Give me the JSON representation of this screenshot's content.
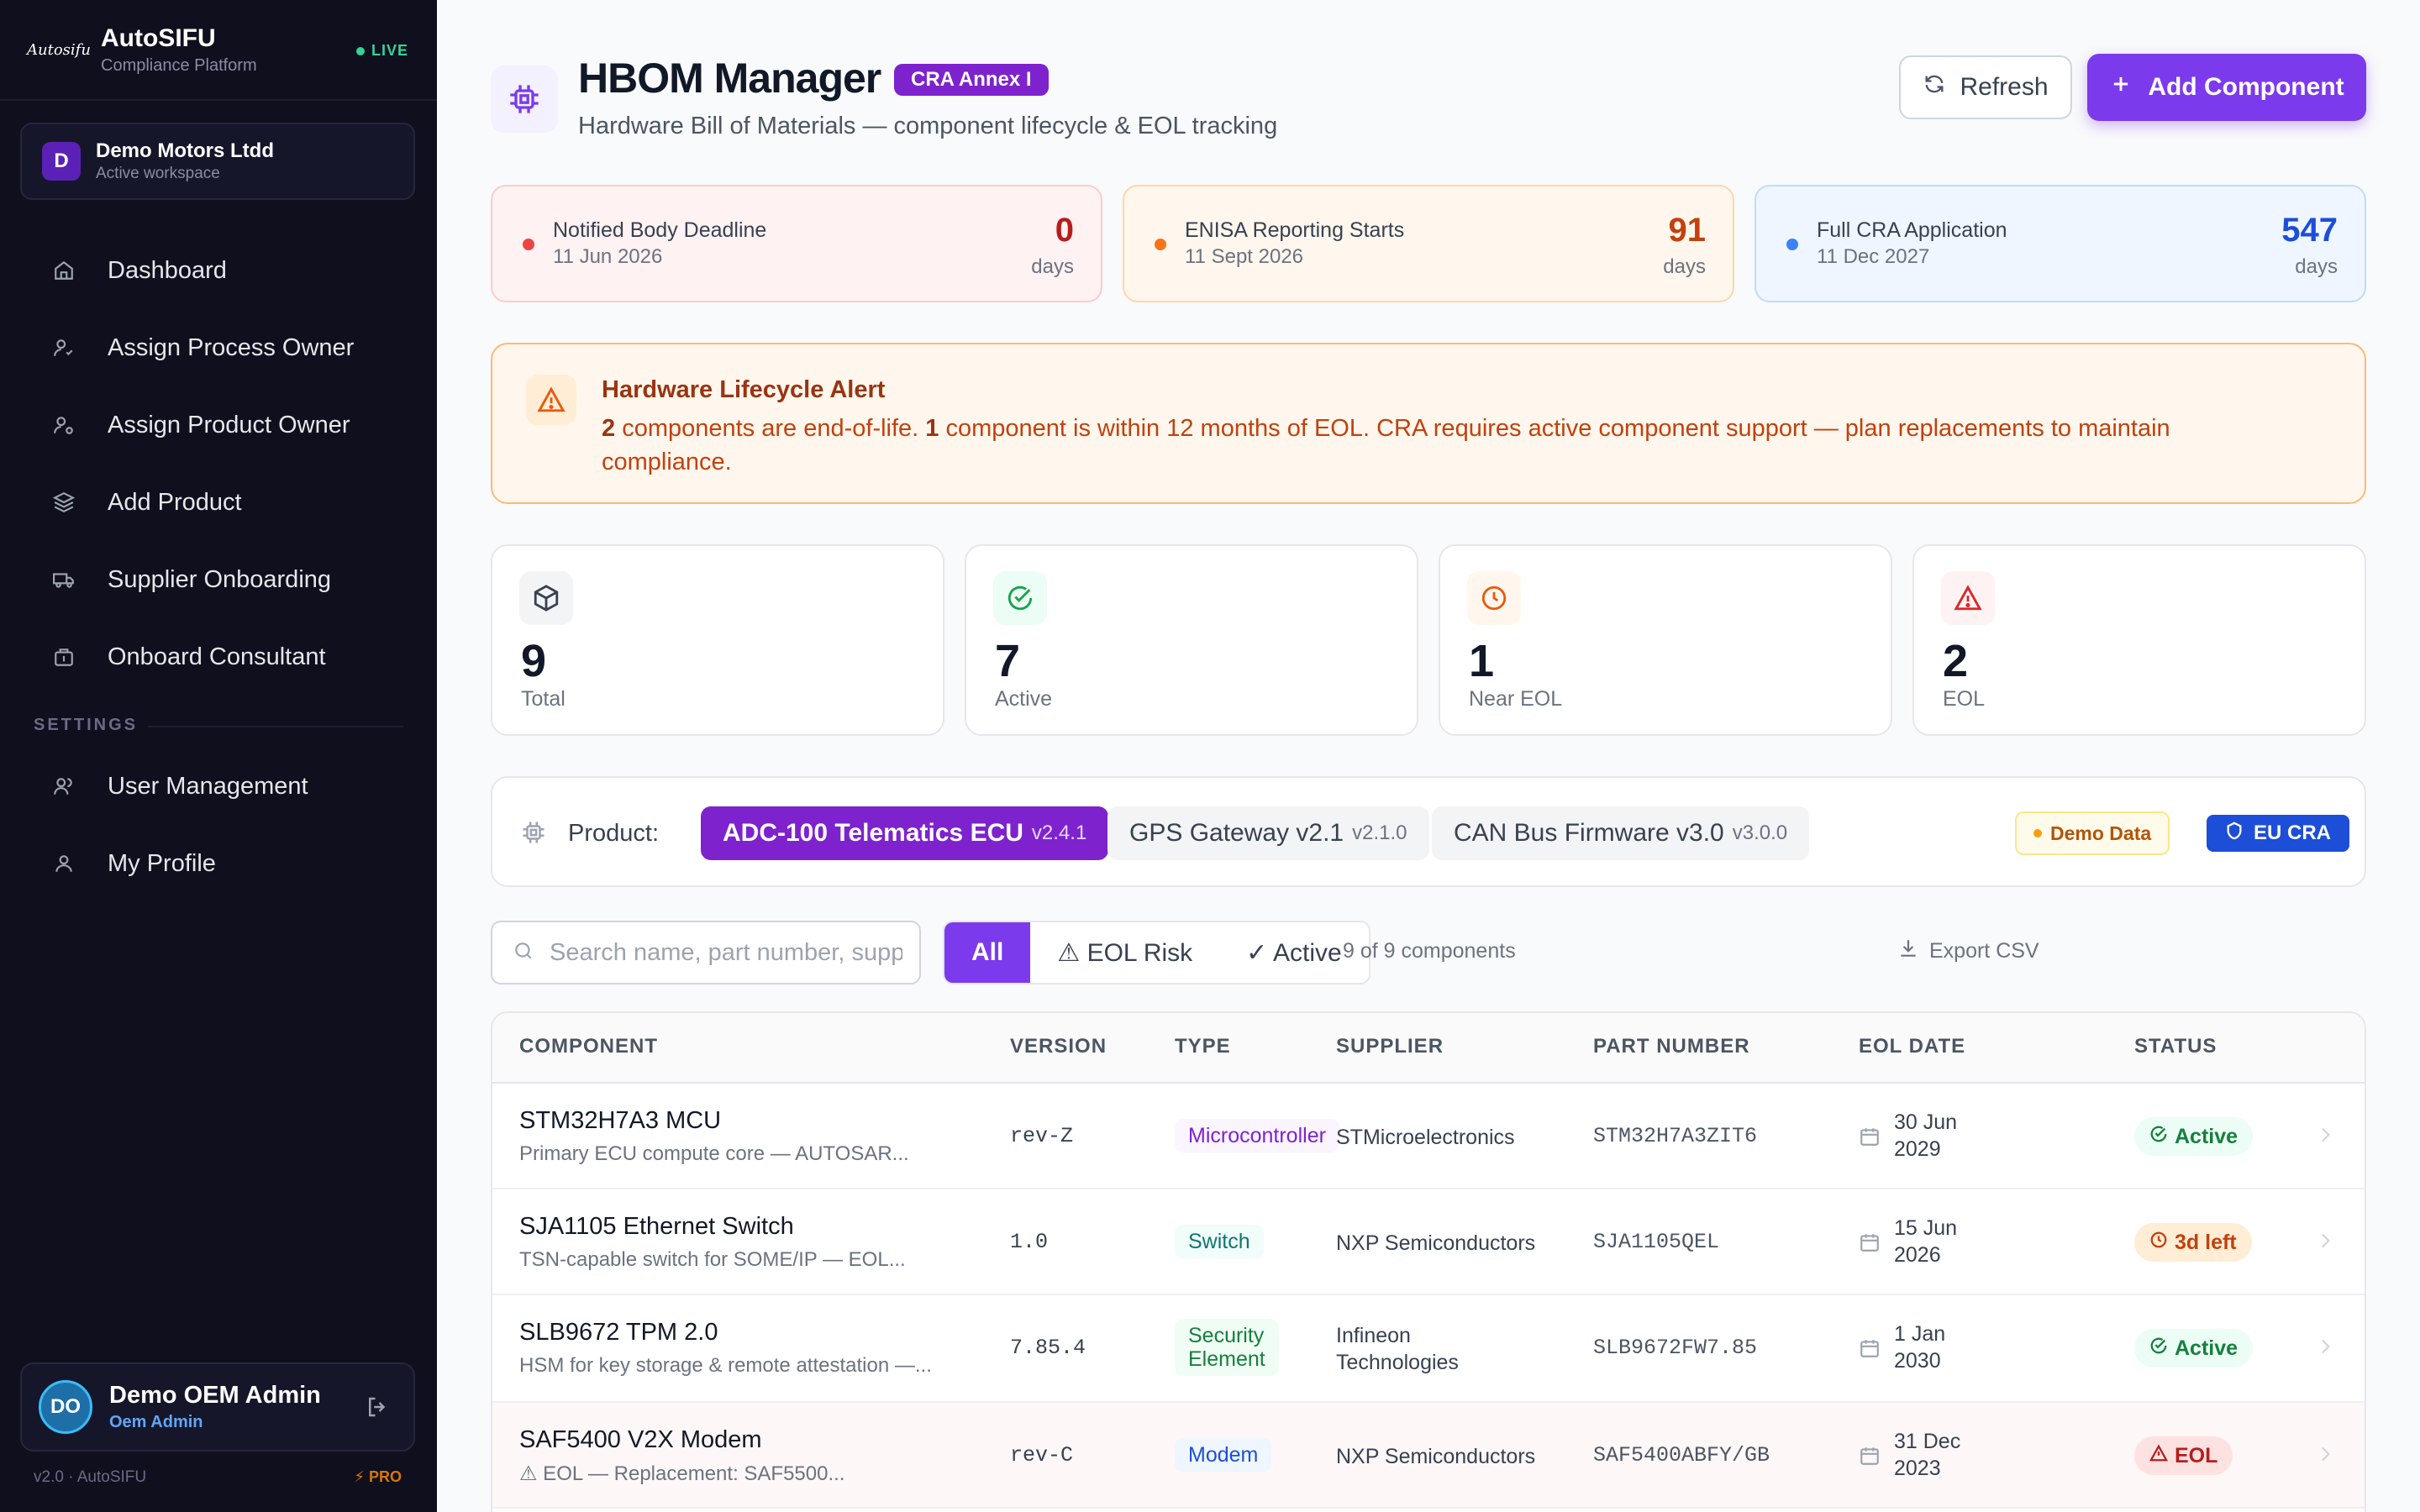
{
  "sidebar": {
    "brand_logo": "Autosifu",
    "brand_name": "AutoSIFU",
    "brand_sub": "Compliance Platform",
    "live": "LIVE",
    "workspace": {
      "initial": "D",
      "name": "Demo Motors Ltdd",
      "sub": "Active workspace"
    },
    "nav": [
      {
        "label": "Dashboard",
        "icon": "home-icon"
      },
      {
        "label": "Assign Process Owner",
        "icon": "user-check-icon"
      },
      {
        "label": "Assign Product Owner",
        "icon": "user-cog-icon"
      },
      {
        "label": "Add Product",
        "icon": "layers-icon"
      },
      {
        "label": "Supplier Onboarding",
        "icon": "truck-icon"
      },
      {
        "label": "Onboard Consultant",
        "icon": "briefcase-icon"
      }
    ],
    "settings_label": "SETTINGS",
    "settings_nav": [
      {
        "label": "User Management",
        "icon": "users-icon"
      },
      {
        "label": "My Profile",
        "icon": "user-icon"
      }
    ],
    "user": {
      "initials": "DO",
      "name": "Demo OEM Admin",
      "role": "Oem Admin"
    },
    "version": "v2.0 · AutoSIFU",
    "pro": "PRO"
  },
  "header": {
    "title": "HBOM Manager",
    "badge": "CRA Annex I",
    "subtitle": "Hardware Bill of Materials — component lifecycle & EOL tracking",
    "refresh_label": "Refresh",
    "add_label": "Add Component"
  },
  "deadlines": [
    {
      "label": "Notified Body Deadline",
      "date": "11 Jun 2026",
      "days": "0",
      "unit": "days",
      "color": "#ef4444"
    },
    {
      "label": "ENISA Reporting Starts",
      "date": "11 Sept 2026",
      "days": "91",
      "unit": "days",
      "color": "#f97316"
    },
    {
      "label": "Full CRA Application",
      "date": "11 Dec 2027",
      "days": "547",
      "unit": "days",
      "color": "#3b82f6"
    }
  ],
  "alert": {
    "title": "Hardware Lifecycle Alert",
    "eol_count": "2",
    "text1": " components are end-of-life. ",
    "near_count": "1",
    "text2": " component is within 12 months of EOL. CRA requires active component support — plan replacements to maintain compliance."
  },
  "stats": [
    {
      "value": "9",
      "label": "Total",
      "icon": "box-icon"
    },
    {
      "value": "7",
      "label": "Active",
      "icon": "check-circle-icon"
    },
    {
      "value": "1",
      "label": "Near EOL",
      "icon": "clock-icon"
    },
    {
      "value": "2",
      "label": "EOL",
      "icon": "warning-icon"
    }
  ],
  "product_bar": {
    "label": "Product:",
    "products": [
      {
        "name": "ADC-100 Telematics ECU",
        "version": "v2.4.1"
      },
      {
        "name": "GPS Gateway v2.1",
        "version": "v2.1.0"
      },
      {
        "name": "CAN Bus Firmware v3.0",
        "version": "v3.0.0"
      }
    ],
    "demo_badge": "Demo Data",
    "eu_badge": "EU CRA"
  },
  "toolbar": {
    "search_placeholder": "Search name, part number, supplier...",
    "filters": [
      "All",
      "⚠ EOL Risk",
      "✓ Active"
    ],
    "count": "9 of 9 components",
    "export": "Export CSV"
  },
  "table": {
    "headers": [
      "COMPONENT",
      "VERSION",
      "TYPE",
      "SUPPLIER",
      "PART NUMBER",
      "EOL DATE",
      "STATUS"
    ],
    "rows": [
      {
        "name": "STM32H7A3 MCU",
        "desc": "Primary ECU compute core — AUTOSAR...",
        "version": "rev-Z",
        "type": "Microcontroller",
        "supplier": "STMicroelectronics",
        "part": "STM32H7A3ZIT6",
        "eol_day": "30 Jun",
        "eol_year": "2029",
        "status": "Active"
      },
      {
        "name": "SJA1105 Ethernet Switch",
        "desc": "TSN-capable switch for SOME/IP — EOL...",
        "version": "1.0",
        "type": "Switch",
        "supplier": "NXP Semiconductors",
        "part": "SJA1105QEL",
        "eol_day": "15 Jun",
        "eol_year": "2026",
        "status": "3d left"
      },
      {
        "name": "SLB9672 TPM 2.0",
        "desc": "HSM for key storage & remote attestation —...",
        "version": "7.85.4",
        "type_line1": "Security",
        "type_line2": "Element",
        "supplier_line1": "Infineon",
        "supplier_line2": "Technologies",
        "part": "SLB9672FW7.85",
        "eol_day": "1 Jan",
        "eol_year": "2030",
        "status": "Active"
      },
      {
        "name": "SAF5400 V2X Modem",
        "desc": "⚠ EOL — Replacement: SAF5500...",
        "version": "rev-C",
        "type": "Modem",
        "supplier": "NXP Semiconductors",
        "part": "SAF5400ABFY/GB",
        "eol_day": "31 Dec",
        "eol_year": "2023",
        "status": "EOL"
      }
    ]
  }
}
